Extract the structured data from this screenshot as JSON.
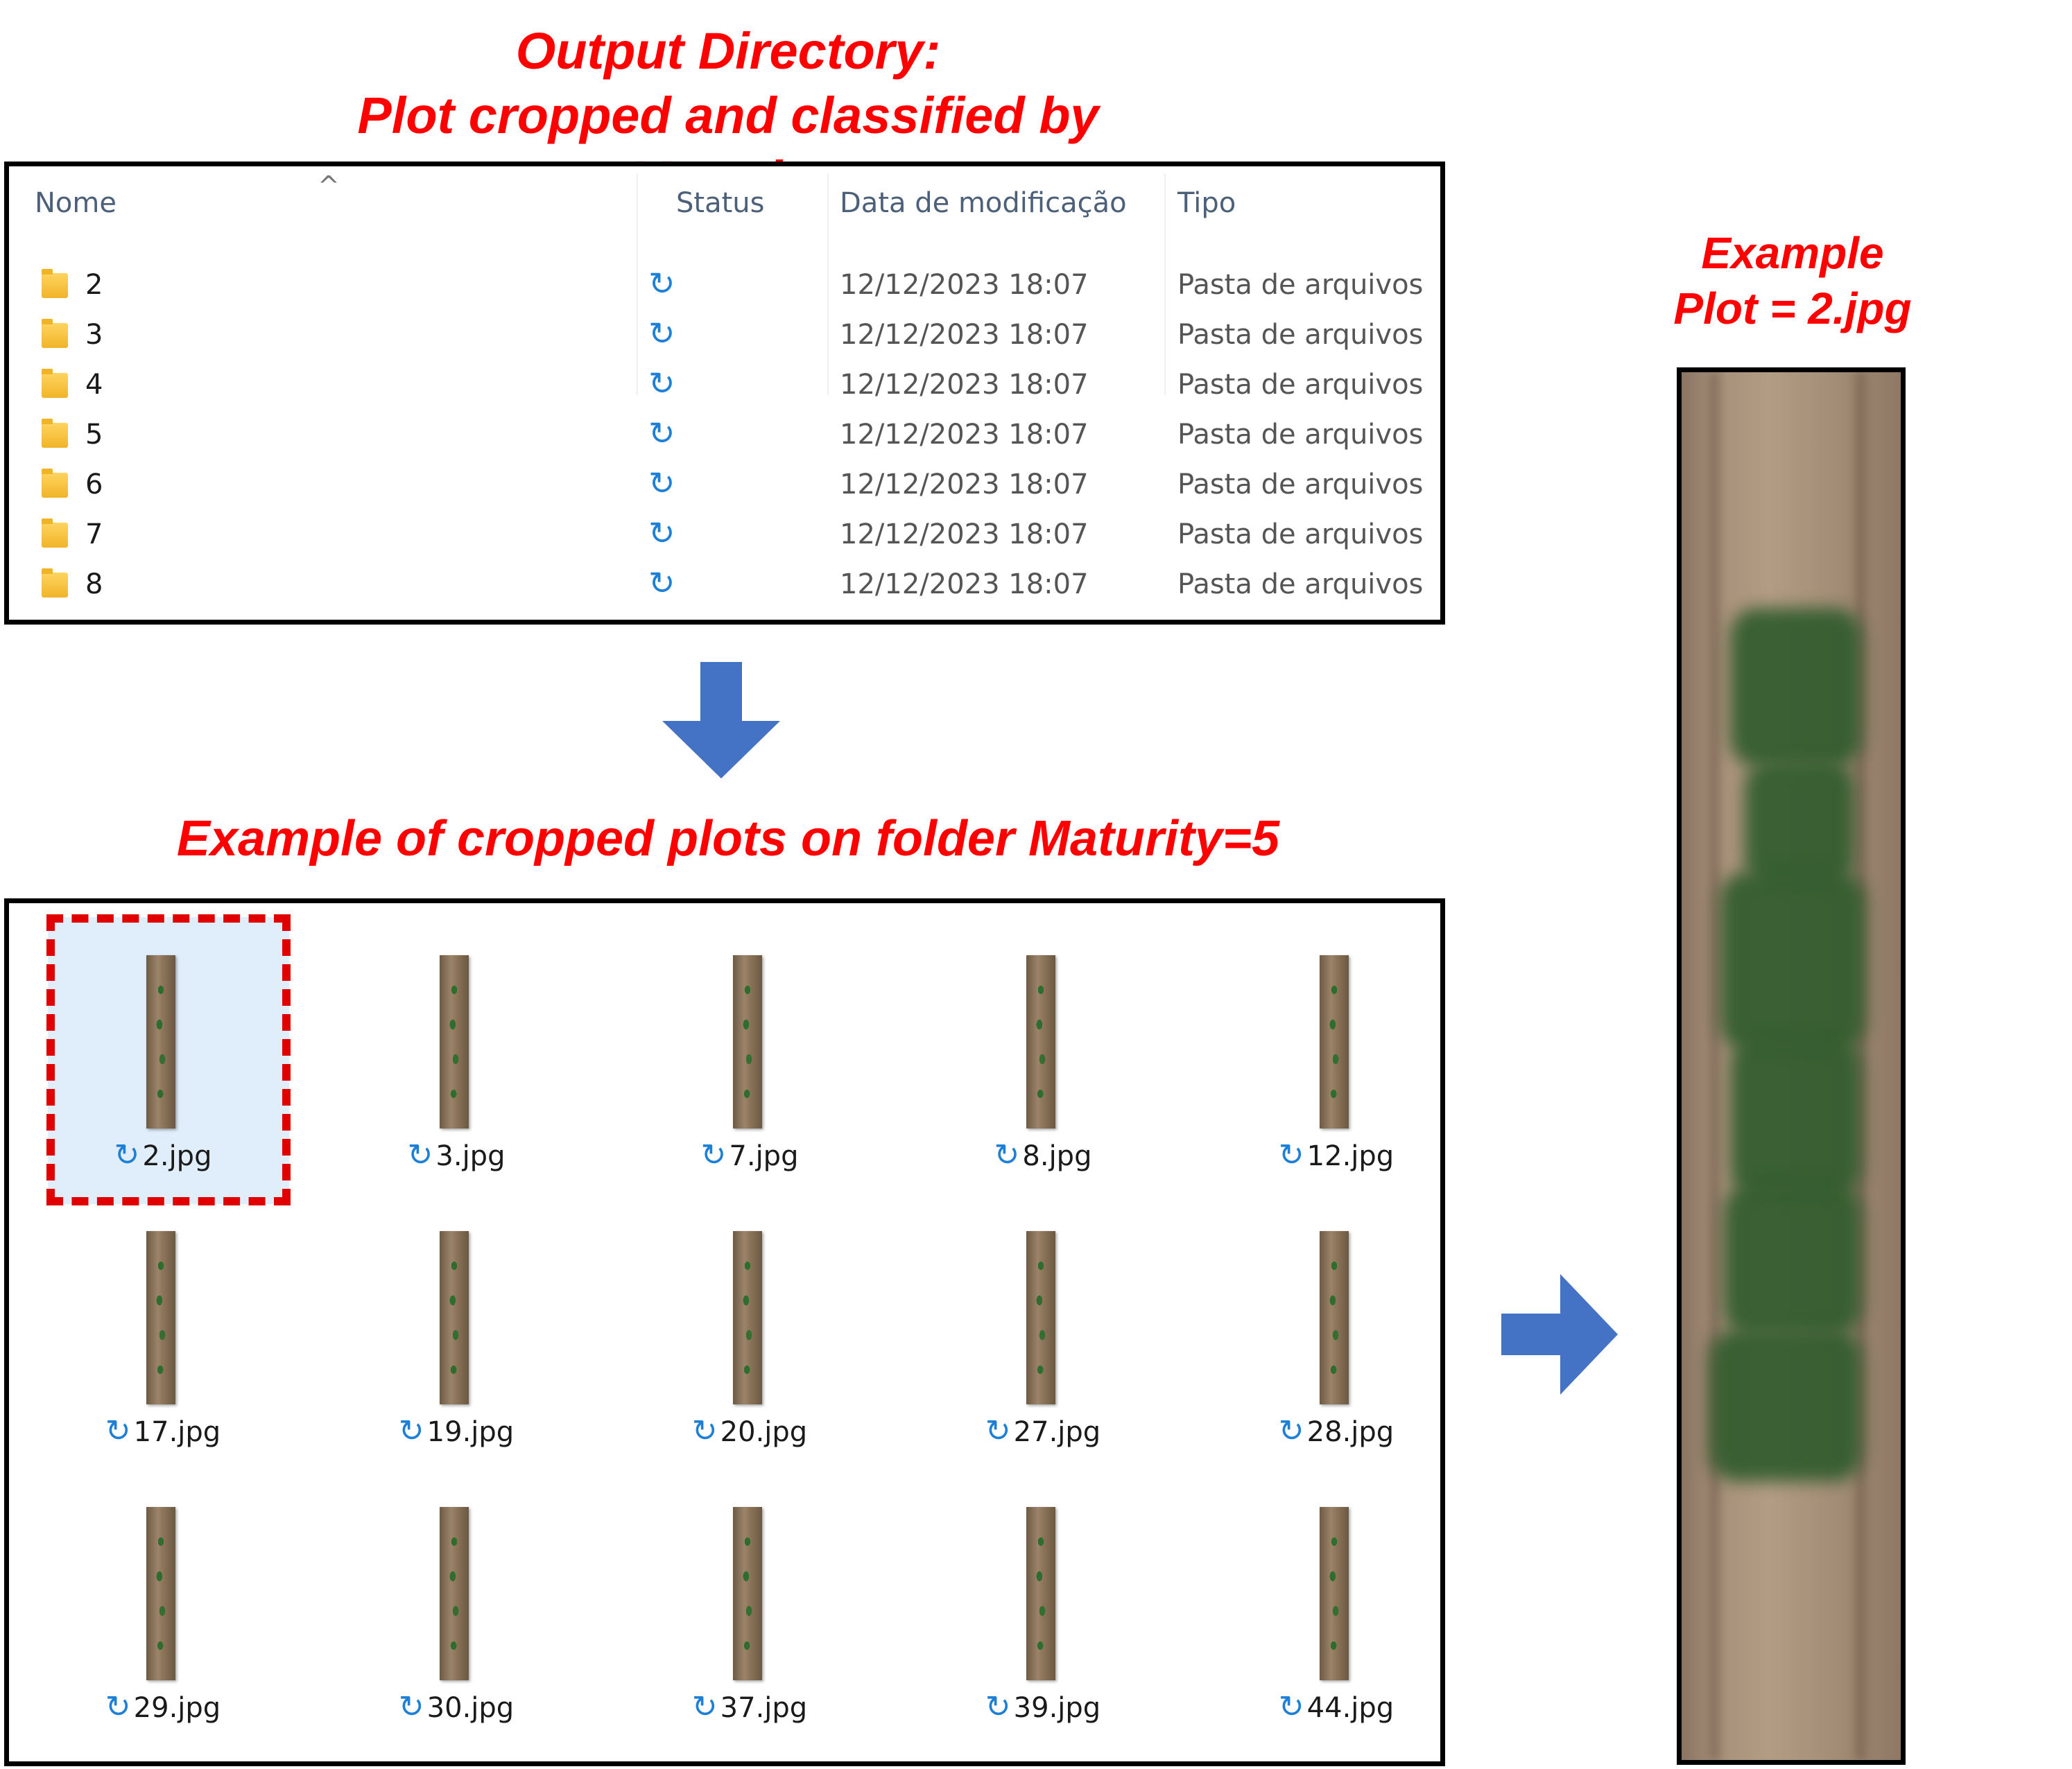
{
  "titles": {
    "output_line1": "Output Directory:",
    "output_line2": "Plot cropped and classified by",
    "output_line3": "Maturity",
    "maturity_example": "Example of cropped plots on folder Maturity=5",
    "plot_line1": "Example",
    "plot_line2": "Plot = 2.jpg"
  },
  "folder_list": {
    "columns": {
      "name": "Nome",
      "status": "Status",
      "date": "Data de modificação",
      "type": "Tipo"
    },
    "rows": [
      {
        "name": "2",
        "status_icon": "sync-icon",
        "date": "12/12/2023 18:07",
        "type": "Pasta de arquivos"
      },
      {
        "name": "3",
        "status_icon": "sync-icon",
        "date": "12/12/2023 18:07",
        "type": "Pasta de arquivos"
      },
      {
        "name": "4",
        "status_icon": "sync-icon",
        "date": "12/12/2023 18:07",
        "type": "Pasta de arquivos"
      },
      {
        "name": "5",
        "status_icon": "sync-icon",
        "date": "12/12/2023 18:07",
        "type": "Pasta de arquivos"
      },
      {
        "name": "6",
        "status_icon": "sync-icon",
        "date": "12/12/2023 18:07",
        "type": "Pasta de arquivos"
      },
      {
        "name": "7",
        "status_icon": "sync-icon",
        "date": "12/12/2023 18:07",
        "type": "Pasta de arquivos"
      },
      {
        "name": "8",
        "status_icon": "sync-icon",
        "date": "12/12/2023 18:07",
        "type": "Pasta de arquivos"
      }
    ]
  },
  "thumbnails": [
    {
      "label": "2.jpg",
      "selected": true
    },
    {
      "label": "3.jpg"
    },
    {
      "label": "7.jpg"
    },
    {
      "label": "8.jpg"
    },
    {
      "label": "12.jpg"
    },
    {
      "label": "17.jpg"
    },
    {
      "label": "19.jpg"
    },
    {
      "label": "20.jpg"
    },
    {
      "label": "27.jpg"
    },
    {
      "label": "28.jpg"
    },
    {
      "label": "29.jpg"
    },
    {
      "label": "30.jpg"
    },
    {
      "label": "37.jpg"
    },
    {
      "label": "39.jpg"
    },
    {
      "label": "44.jpg"
    }
  ],
  "icons": {
    "sync": "sync-icon",
    "folder": "folder-icon",
    "arrow_down": "arrow-down-icon",
    "arrow_right": "arrow-right-icon"
  },
  "colors": {
    "title_red": "#ff0000",
    "arrow_blue": "#4472c4",
    "sync_blue": "#1e7fd6",
    "selection_red": "#e00000"
  }
}
